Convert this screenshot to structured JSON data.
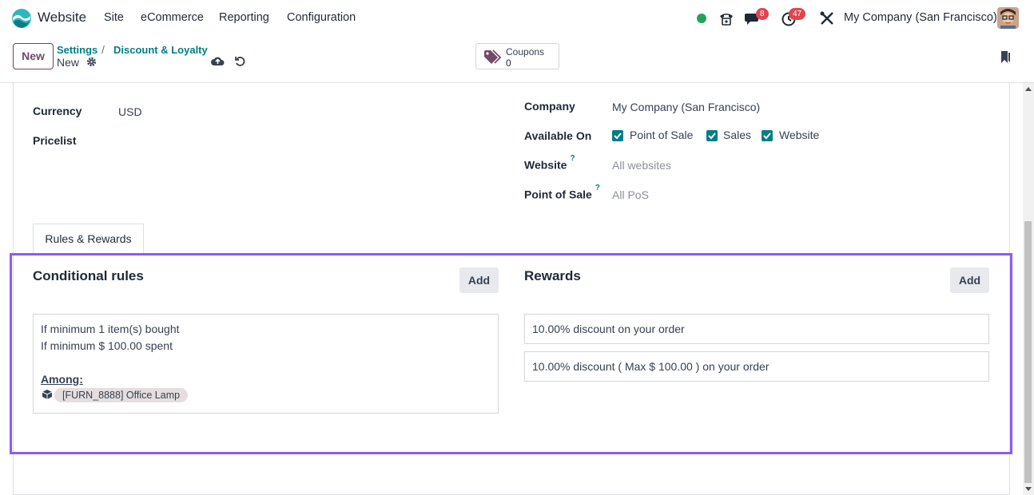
{
  "nav": {
    "app_name": "Website",
    "menu": [
      "Site",
      "eCommerce",
      "Reporting",
      "Configuration"
    ],
    "messages_badge": "8",
    "activity_badge": "47",
    "company": "My Company (San Francisco)",
    "status_color": "#22a35a"
  },
  "control_panel": {
    "new_label": "New",
    "breadcrumb_settings": "Settings",
    "breadcrumb_sep": "/",
    "breadcrumb_current": "Discount & Loyalty",
    "record_name": "New",
    "coupons_label": "Coupons",
    "coupons_count": "0"
  },
  "form": {
    "currency_label": "Currency",
    "currency_value": "USD",
    "pricelist_label": "Pricelist",
    "company_label": "Company",
    "company_value": "My Company (San Francisco)",
    "available_on_label": "Available On",
    "available_on": [
      "Point of Sale",
      "Sales",
      "Website"
    ],
    "website_label": "Website",
    "website_placeholder": "All websites",
    "pos_label": "Point of Sale",
    "pos_placeholder": "All PoS",
    "help_mark": "?"
  },
  "tabs": [
    "Rules & Rewards"
  ],
  "rules": {
    "title": "Conditional rules",
    "add_label": "Add",
    "lines": [
      "If minimum 1 item(s) bought",
      "If minimum $ 100.00 spent"
    ],
    "among_label": "Among:",
    "product": "[FURN_8888] Office Lamp"
  },
  "rewards": {
    "title": "Rewards",
    "add_label": "Add",
    "items": [
      "10.00% discount on your order",
      "10.00% discount ( Max $ 100.00 ) on your order"
    ]
  },
  "colors": {
    "accent": "#017e84",
    "brand": "#714b67",
    "highlight": "#8b5cf6",
    "badge": "#e0454f"
  }
}
